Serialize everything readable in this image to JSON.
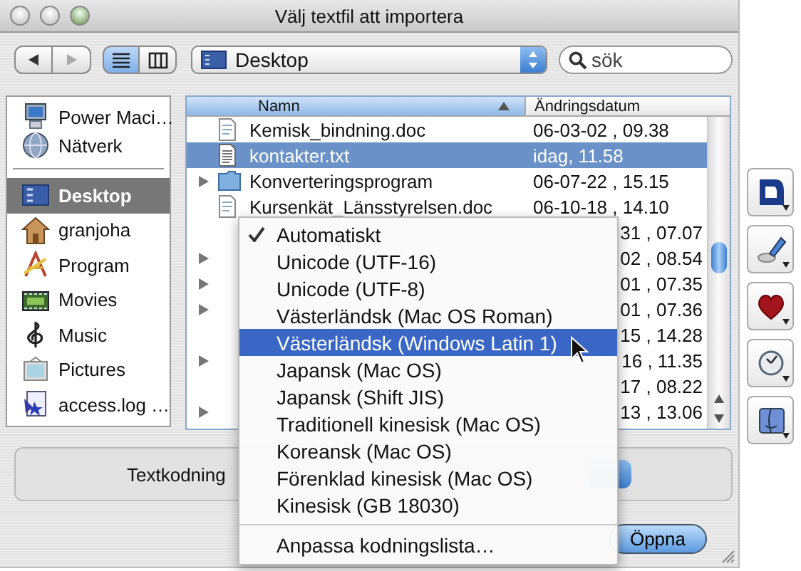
{
  "window": {
    "title": "Välj textfil att importera"
  },
  "toolbar": {
    "nav_buttons": [
      {
        "kind": "back",
        "disabled": false
      },
      {
        "kind": "forward",
        "disabled": true
      }
    ],
    "view_buttons": [
      {
        "kind": "list",
        "selected": true
      },
      {
        "kind": "columns",
        "selected": false
      }
    ],
    "location_popup": {
      "label": "Desktop"
    },
    "search": {
      "placeholder": "sök"
    }
  },
  "sidebar": {
    "sections": [
      [
        {
          "label": "Power Maci…",
          "kind": "computer",
          "selected": false
        },
        {
          "label": "Nätverk",
          "kind": "network",
          "selected": false
        }
      ],
      [
        {
          "label": "Desktop",
          "kind": "desktop",
          "selected": true
        },
        {
          "label": "granjoha",
          "kind": "home",
          "selected": false
        },
        {
          "label": "Program",
          "kind": "applications",
          "selected": false
        },
        {
          "label": "Movies",
          "kind": "movies",
          "selected": false
        },
        {
          "label": "Music",
          "kind": "music",
          "selected": false
        },
        {
          "label": "Pictures",
          "kind": "pictures",
          "selected": false
        },
        {
          "label": "access.log …",
          "kind": "document",
          "selected": false
        }
      ]
    ]
  },
  "file_list": {
    "columns": [
      {
        "label": "Namn",
        "sorted": true
      },
      {
        "label": "Ändringsdatum",
        "sorted": false
      }
    ],
    "rows": [
      {
        "name": "Kemisk_bindning.doc",
        "date": "06-03-02 , 09.38",
        "kind": "doc",
        "selected": false,
        "expandable": false
      },
      {
        "name": "kontakter.txt",
        "date": "idag, 11.58",
        "kind": "text",
        "selected": true,
        "expandable": false
      },
      {
        "name": "Konverteringsprogram",
        "date": "06-07-22 , 15.15",
        "kind": "folder",
        "selected": false,
        "expandable": true
      },
      {
        "name": "Kursenkät_Länsstyrelsen.doc",
        "date": "06-10-18 , 14.10",
        "kind": "doc",
        "selected": false,
        "expandable": false
      },
      {
        "date": "31 , 07.07",
        "selected": false,
        "expandable": false
      },
      {
        "date": "02 , 08.54",
        "selected": false,
        "expandable": true
      },
      {
        "date": "01 , 07.35",
        "selected": false,
        "expandable": true
      },
      {
        "date": "01 , 07.36",
        "selected": false,
        "expandable": true
      },
      {
        "date": "15 , 14.28",
        "selected": false,
        "expandable": false
      },
      {
        "date": "16 , 11.35",
        "selected": false,
        "expandable": true
      },
      {
        "date": "17 , 08.22",
        "selected": false,
        "expandable": false
      },
      {
        "date": "13 , 13.06",
        "selected": false,
        "expandable": true
      }
    ]
  },
  "encoding": {
    "label": "Textkodning"
  },
  "encoding_menu": {
    "items": [
      {
        "label": "Automatiskt",
        "checked": true,
        "selected": false
      },
      {
        "label": "Unicode (UTF-16)",
        "checked": false,
        "selected": false
      },
      {
        "label": "Unicode (UTF-8)",
        "checked": false,
        "selected": false
      },
      {
        "label": "Västerländsk (Mac OS Roman)",
        "checked": false,
        "selected": false
      },
      {
        "label": "Västerländsk (Windows Latin 1)",
        "checked": false,
        "selected": true
      },
      {
        "label": "Japansk (Mac OS)",
        "checked": false,
        "selected": false
      },
      {
        "label": "Japansk (Shift JIS)",
        "checked": false,
        "selected": false
      },
      {
        "label": "Traditionell kinesisk (Mac OS)",
        "checked": false,
        "selected": false
      },
      {
        "label": "Koreansk (Mac OS)",
        "checked": false,
        "selected": false
      },
      {
        "label": "Förenklad kinesisk (Mac OS)",
        "checked": false,
        "selected": false
      },
      {
        "label": "Kinesisk (GB 18030)",
        "checked": false,
        "selected": false
      }
    ],
    "footer_item": "Anpassa kodningslista…"
  },
  "open_button": {
    "label": "Öppna"
  },
  "dock": [
    {
      "kind": "document"
    },
    {
      "kind": "pen"
    },
    {
      "kind": "heart"
    },
    {
      "kind": "clock"
    },
    {
      "kind": "face"
    }
  ]
}
